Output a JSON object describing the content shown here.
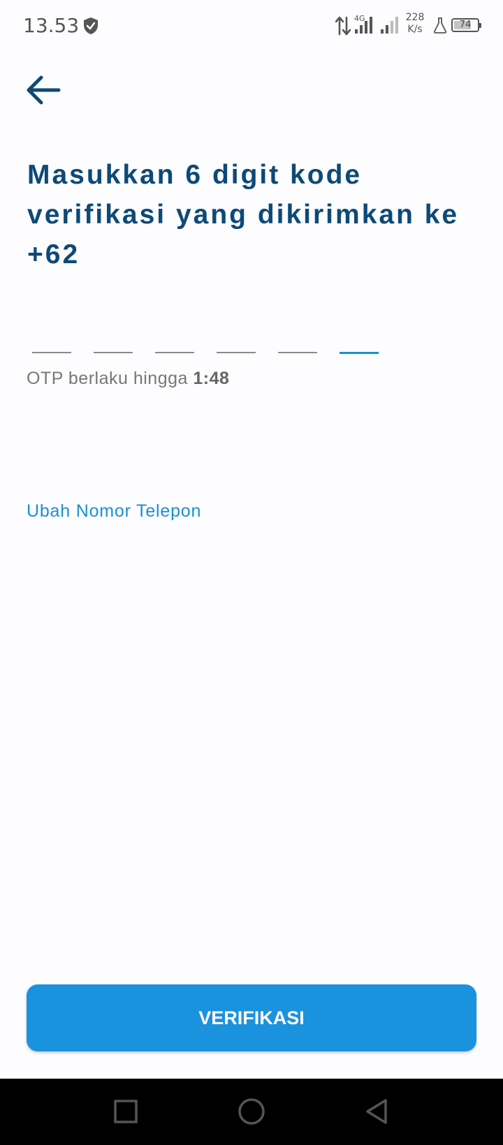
{
  "status_bar": {
    "time": "13.53",
    "network_type": "4G",
    "speed_value": "228",
    "speed_unit": "K/s",
    "battery_level": "74",
    "battery_fraction": 0.74,
    "icons": [
      "shield-icon",
      "data-arrows-icon",
      "signal-icon",
      "flask-icon",
      "battery-icon"
    ]
  },
  "header": {
    "back_icon": "arrow-left-icon"
  },
  "main": {
    "title": "Masukkan 6 digit kode verifikasi yang dikirimkan ke +62",
    "otp": {
      "digit_count": 6,
      "values": [
        "",
        "",
        "",
        "",
        "",
        ""
      ],
      "active_index": 5
    },
    "timer_label": "OTP berlaku hingga",
    "timer_value": "1:48",
    "change_number_label": "Ubah Nomor Telepon"
  },
  "footer": {
    "verify_label": "VERIFIKASI"
  },
  "nav_bar": {
    "icons": [
      "recent-apps-icon",
      "home-icon",
      "back-nav-icon"
    ]
  },
  "colors": {
    "title": "#0c4a77",
    "accent": "#1a8fd3",
    "button": "#1b92de",
    "background": "#fdfcfe"
  }
}
